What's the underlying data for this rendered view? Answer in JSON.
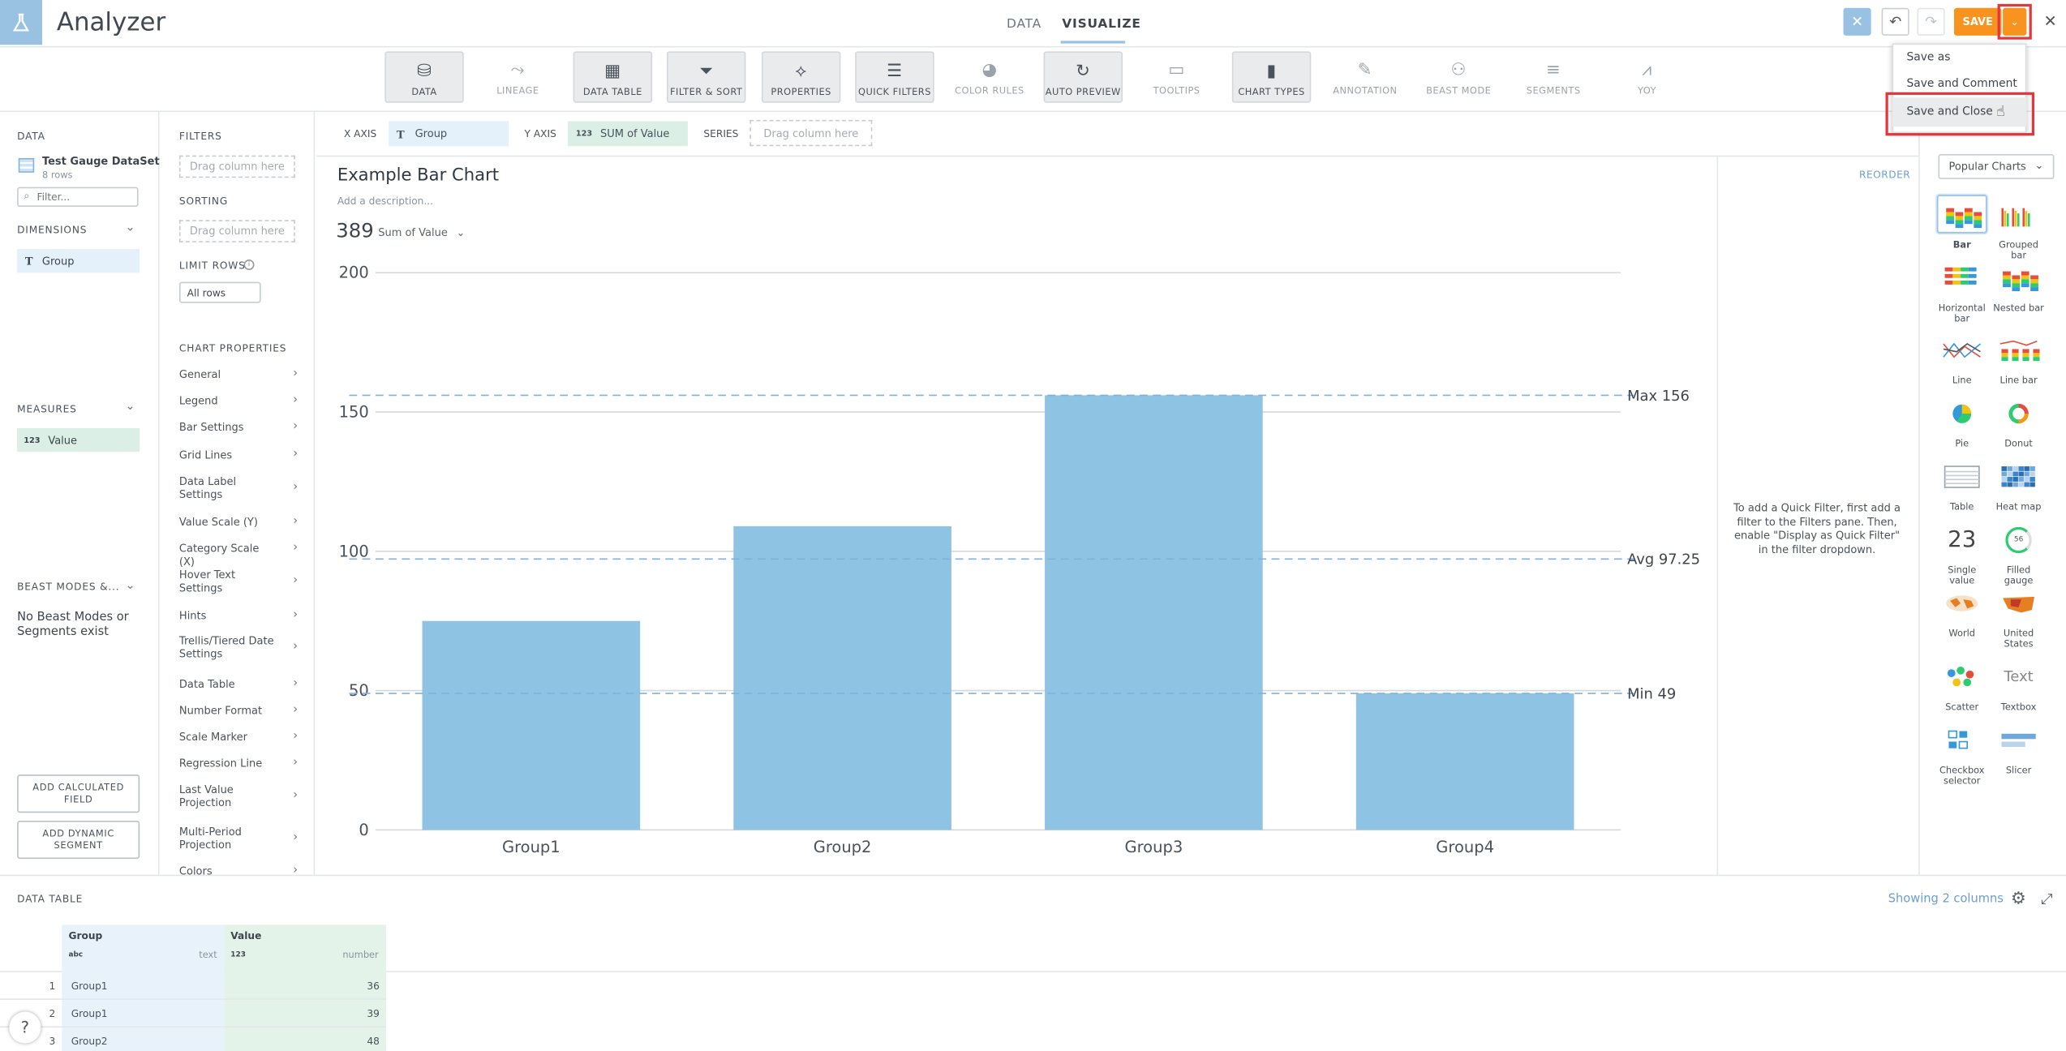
{
  "app": {
    "title": "Analyzer"
  },
  "nav": {
    "data": "DATA",
    "visualize": "VISUALIZE"
  },
  "header": {
    "save_label": "SAVE"
  },
  "save_menu": {
    "items": [
      "Save as",
      "Save and Comment",
      "Save and Close"
    ],
    "highlighted": "Save and Close"
  },
  "toolbar": {
    "items": [
      "DATA",
      "LINEAGE",
      "DATA TABLE",
      "FILTER & SORT",
      "PROPERTIES",
      "QUICK FILTERS",
      "COLOR RULES",
      "AUTO PREVIEW",
      "TOOLTIPS",
      "CHART TYPES",
      "ANNOTATION",
      "BEAST MODE",
      "SEGMENTS",
      "YOY"
    ]
  },
  "data_panel": {
    "heading": "DATA",
    "dataset_name": "Test Gauge DataSet",
    "dataset_rows": "8 rows",
    "filter_placeholder": "Filter...",
    "dimensions_heading": "DIMENSIONS",
    "dimension_items": [
      "Group"
    ],
    "measures_heading": "MEASURES",
    "measure_items": [
      "Value"
    ],
    "beast_heading": "BEAST MODES &...",
    "beast_empty": "No Beast Modes or Segments exist",
    "add_calc": "ADD CALCULATED FIELD",
    "add_segment": "ADD DYNAMIC SEGMENT"
  },
  "filters_panel": {
    "filters_heading": "FILTERS",
    "filters_drop": "Drag column here",
    "sorting_heading": "SORTING",
    "sorting_drop": "Drag column here",
    "limit_heading": "LIMIT ROWS",
    "limit_value": "All rows",
    "chart_props_heading": "CHART PROPERTIES",
    "props": [
      "General",
      "Legend",
      "Bar Settings",
      "Grid Lines",
      "Data Label Settings",
      "Value Scale (Y)",
      "Category Scale (X)",
      "Hover Text Settings",
      "Hints",
      "Trellis/Tiered Date Settings",
      "Data Table",
      "Number Format",
      "Scale Marker",
      "Regression Line",
      "Last Value Projection",
      "Multi-Period Projection",
      "Colors"
    ]
  },
  "axis_bar": {
    "x_label": "X AXIS",
    "x_value": "Group",
    "y_label": "Y AXIS",
    "y_value": "SUM of Value",
    "y_type": "123",
    "series_label": "SERIES",
    "series_drop": "Drag column here"
  },
  "chart_header": {
    "title": "Example Bar Chart",
    "description_placeholder": "Add a description...",
    "summary_value": "389",
    "summary_label": "Sum of Value"
  },
  "chart_data": {
    "type": "bar",
    "categories": [
      "Group1",
      "Group2",
      "Group3",
      "Group4"
    ],
    "values": [
      75,
      109,
      156,
      49
    ],
    "ylim": [
      0,
      200
    ],
    "yticks": [
      0,
      50,
      100,
      150,
      200
    ],
    "grid": true,
    "color": "#8fc3e3",
    "reference_lines": [
      {
        "label": "Max 156",
        "value": 156
      },
      {
        "label": "Avg 97.25",
        "value": 97.25
      },
      {
        "label": "Min 49",
        "value": 49
      }
    ]
  },
  "quick_filter_info": {
    "reorder": "REORDER",
    "message": "To add a Quick Filter, first add a filter to the Filters pane. Then, enable \"Display as Quick Filter\" in the filter dropdown."
  },
  "chart_types": {
    "dropdown": "Popular Charts",
    "selected": "Bar",
    "items": [
      "Bar",
      "Grouped bar",
      "Horizontal bar",
      "Nested bar",
      "Line",
      "Line bar",
      "Pie",
      "Donut",
      "Table",
      "Heat map",
      "Single value",
      "Filled gauge",
      "World",
      "United States",
      "Scatter",
      "Textbox",
      "Checkbox selector",
      "Slicer"
    ],
    "single_value_sample": "23",
    "textbox_sample": "Text",
    "gauge_sample": "56"
  },
  "data_table": {
    "heading": "DATA TABLE",
    "showing": "Showing 2 columns",
    "columns": [
      {
        "name": "Group",
        "type_icon": "abc",
        "type": "text"
      },
      {
        "name": "Value",
        "type_icon": "123",
        "type": "number"
      }
    ],
    "rows": [
      {
        "n": "1",
        "group": "Group1",
        "value": "36"
      },
      {
        "n": "2",
        "group": "Group1",
        "value": "39"
      },
      {
        "n": "3",
        "group": "Group2",
        "value": "48"
      }
    ]
  },
  "help": {
    "label": "?"
  },
  "colors": {
    "accent": "#f7931e",
    "dimension": "#e4f0fa",
    "measure": "#dcefe6",
    "highlight_box": "#e0383e",
    "bar": "#8fc3e3"
  }
}
